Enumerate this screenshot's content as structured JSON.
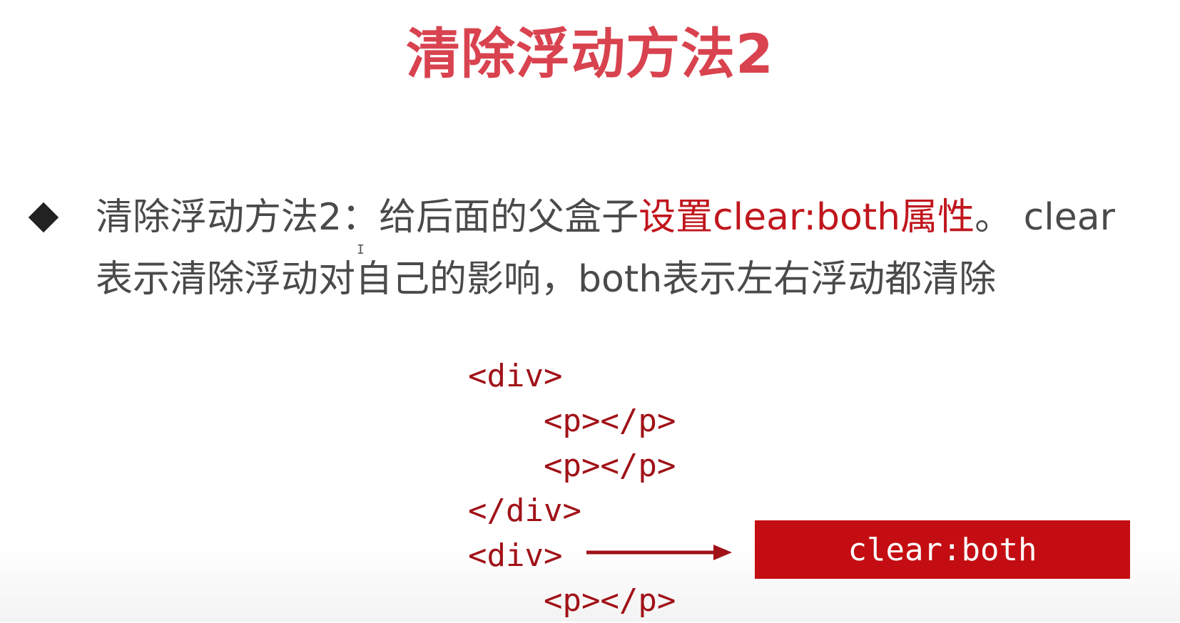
{
  "slide": {
    "title": "清除浮动方法2",
    "bullet": {
      "text_before": "清除浮动方法2：给后面的父盒子",
      "highlight": "设置clear:both属性",
      "text_after": "。 clear表示清除浮动对自己的影响，both表示左右浮动都清除"
    },
    "code_lines": [
      "<div>",
      "    <p></p>",
      "    <p></p>",
      "</div>",
      "<div>",
      "    <p></p>"
    ],
    "callout_label": "clear:both",
    "cursor_glyph": "I"
  },
  "colors": {
    "title": "#d8434f",
    "highlight": "#c0161d",
    "code": "#a01218",
    "callout_bg": "#c40d12"
  }
}
